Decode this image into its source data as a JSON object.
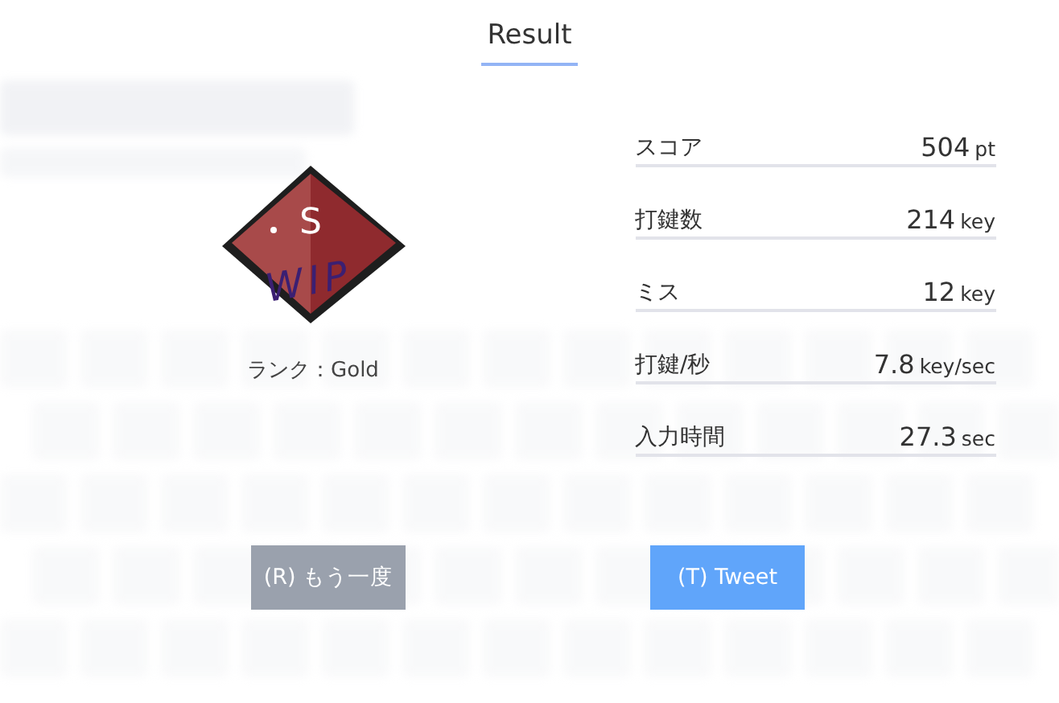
{
  "title": "Result",
  "badge": {
    "letter": "S",
    "overlay": "WIP"
  },
  "rank_label": "ランク：Gold",
  "stats": [
    {
      "label": "スコア",
      "value": "504",
      "unit": "pt"
    },
    {
      "label": "打鍵数",
      "value": "214",
      "unit": "key"
    },
    {
      "label": "ミス",
      "value": "12",
      "unit": "key"
    },
    {
      "label": "打鍵/秒",
      "value": "7.8",
      "unit": "key/sec"
    },
    {
      "label": "入力時間",
      "value": "27.3",
      "unit": "sec"
    }
  ],
  "buttons": [
    {
      "label": "(R) もう一度",
      "kind": "retry"
    },
    {
      "label": "(T) Tweet",
      "kind": "tweet"
    }
  ]
}
